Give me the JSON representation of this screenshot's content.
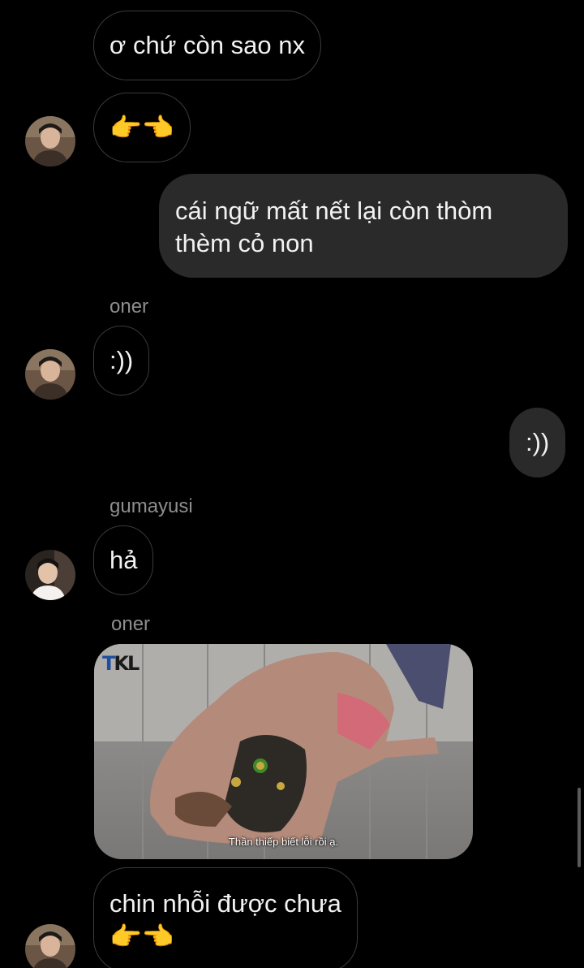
{
  "messages": [
    {
      "text": "ơ chứ còn sao nx"
    },
    {
      "emoji": "👉👈"
    },
    {
      "line1": "cái ngữ mất nết lại còn thòm",
      "line2": "thèm cỏ non"
    },
    {
      "sender": "oner"
    },
    {
      "text": ":))"
    },
    {
      "text": ":))"
    },
    {
      "sender": "gumayusi"
    },
    {
      "text": "hả"
    },
    {
      "sender": "oner"
    },
    {
      "image_caption": "Thần thiếp biết lỗi rồi ạ.",
      "image_logo_t": "T",
      "image_logo_kl": "KL"
    },
    {
      "text": "chin nhỗi được chưa",
      "emoji": "👉👈"
    }
  ],
  "colors": {
    "background": "#000000",
    "incoming_border": "#3a3a3a",
    "outgoing_bubble": "#2a2a2a",
    "sender_name": "#8e8e8e"
  },
  "icons": [
    "avatar-oner",
    "avatar-gumayusi"
  ]
}
